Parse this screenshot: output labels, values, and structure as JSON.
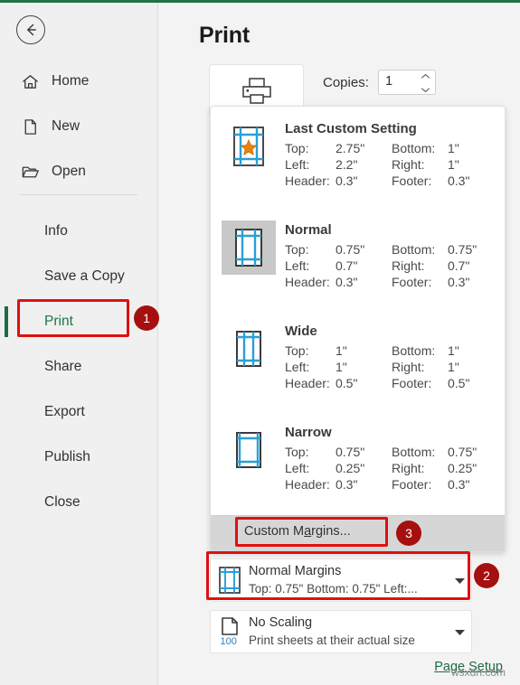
{
  "app": {
    "accent_green": "#217346",
    "highlight_red": "#e01010",
    "badge_red": "#a60f0f"
  },
  "sidebar": {
    "back_button": "back-arrow",
    "top_items": [
      {
        "label": "Home",
        "icon": "home-icon"
      },
      {
        "label": "New",
        "icon": "new-document-icon"
      },
      {
        "label": "Open",
        "icon": "open-folder-icon"
      }
    ],
    "bottom_items": [
      {
        "label": "Info",
        "selected": false
      },
      {
        "label": "Save a Copy",
        "selected": false
      },
      {
        "label": "Print",
        "selected": true
      },
      {
        "label": "Share",
        "selected": false
      },
      {
        "label": "Export",
        "selected": false
      },
      {
        "label": "Publish",
        "selected": false
      },
      {
        "label": "Close",
        "selected": false
      }
    ]
  },
  "main": {
    "title": "Print",
    "print_button_icon": "printer-icon",
    "copies_label": "Copies:",
    "copies_value": "1",
    "page_setup_link": "Page Setup"
  },
  "margins_menu": {
    "presets": [
      {
        "name": "Last Custom Setting",
        "icon": "margin-custom-star-icon",
        "selected": false,
        "rows": [
          {
            "l1": "Top:",
            "v1": "2.75\"",
            "l2": "Bottom:",
            "v2": "1\""
          },
          {
            "l1": "Left:",
            "v1": "2.2\"",
            "l2": "Right:",
            "v2": "1\""
          },
          {
            "l1": "Header:",
            "v1": "0.3\"",
            "l2": "Footer:",
            "v2": "0.3\""
          }
        ]
      },
      {
        "name": "Normal",
        "icon": "margin-normal-icon",
        "selected": true,
        "rows": [
          {
            "l1": "Top:",
            "v1": "0.75\"",
            "l2": "Bottom:",
            "v2": "0.75\""
          },
          {
            "l1": "Left:",
            "v1": "0.7\"",
            "l2": "Right:",
            "v2": "0.7\""
          },
          {
            "l1": "Header:",
            "v1": "0.3\"",
            "l2": "Footer:",
            "v2": "0.3\""
          }
        ]
      },
      {
        "name": "Wide",
        "icon": "margin-wide-icon",
        "selected": false,
        "rows": [
          {
            "l1": "Top:",
            "v1": "1\"",
            "l2": "Bottom:",
            "v2": "1\""
          },
          {
            "l1": "Left:",
            "v1": "1\"",
            "l2": "Right:",
            "v2": "1\""
          },
          {
            "l1": "Header:",
            "v1": "0.5\"",
            "l2": "Footer:",
            "v2": "0.5\""
          }
        ]
      },
      {
        "name": "Narrow",
        "icon": "margin-narrow-icon",
        "selected": false,
        "rows": [
          {
            "l1": "Top:",
            "v1": "0.75\"",
            "l2": "Bottom:",
            "v2": "0.75\""
          },
          {
            "l1": "Left:",
            "v1": "0.25\"",
            "l2": "Right:",
            "v2": "0.25\""
          },
          {
            "l1": "Header:",
            "v1": "0.3\"",
            "l2": "Footer:",
            "v2": "0.3\""
          }
        ]
      }
    ],
    "custom_margins": {
      "prefix": "Custom M",
      "accel": "a",
      "suffix": "rgins..."
    }
  },
  "settings": {
    "margins_combo": {
      "icon": "margin-normal-icon",
      "title": "Normal Margins",
      "subtitle": "Top: 0.75\" Bottom: 0.75\" Left:..."
    },
    "scaling_combo": {
      "icon": "scaling-100-icon",
      "title": "No Scaling",
      "subtitle": "Print sheets at their actual size"
    }
  },
  "annotations": {
    "badges": [
      "1",
      "2",
      "3"
    ]
  },
  "watermark": "wsxdn.com"
}
